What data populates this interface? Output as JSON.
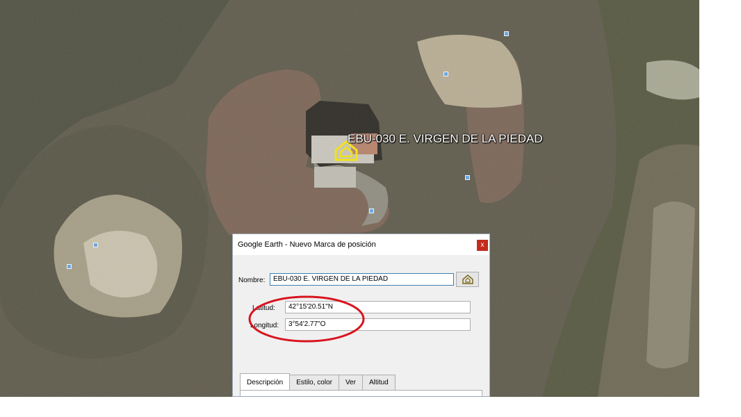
{
  "map": {
    "placemark_label": "EBU-030 E. VIRGEN DE LA PIEDAD",
    "placemark_icon": "home-icon"
  },
  "dialog": {
    "title": "Google Earth - Nuevo Marca de posición",
    "close_label": "x",
    "name_label": "Nombre:",
    "name_value": "EBU-030 E. VIRGEN DE LA PIEDAD",
    "icon_button": "home-icon",
    "latitude_label": "Latitud:",
    "latitude_value": "42°15'20.51\"N",
    "longitude_label": "Longitud:",
    "longitude_value": "3°54'2.77\"O",
    "tabs": [
      {
        "label": "Descripción",
        "active": true
      },
      {
        "label": "Estilo, color",
        "active": false
      },
      {
        "label": "Ver",
        "active": false
      },
      {
        "label": "Altitud",
        "active": false
      }
    ]
  },
  "annotation": {
    "ellipse_color": "#d8141e"
  }
}
